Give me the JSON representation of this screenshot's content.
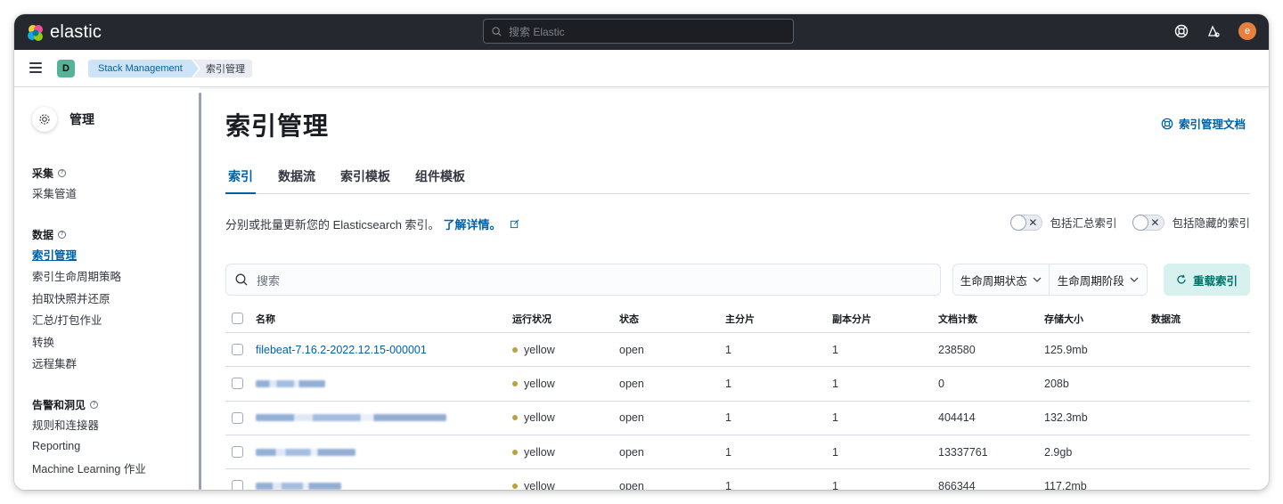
{
  "header": {
    "brand": "elastic",
    "search_placeholder": "搜索 Elastic",
    "user_initial": "e"
  },
  "breadcrumbs": {
    "space_initial": "D",
    "items": [
      "Stack Management",
      "索引管理"
    ]
  },
  "sidebar": {
    "title": "管理",
    "groups": [
      {
        "title": "采集",
        "items": [
          "采集管道"
        ]
      },
      {
        "title": "数据",
        "items": [
          "索引管理",
          "索引生命周期策略",
          "拍取快照并还原",
          "汇总/打包作业",
          "转换",
          "远程集群"
        ]
      },
      {
        "title": "告警和洞见",
        "items": [
          "规则和连接器",
          "Reporting",
          "Machine Learning 作业"
        ]
      }
    ]
  },
  "main": {
    "title": "索引管理",
    "doc_link": "索引管理文档",
    "tabs": [
      "索引",
      "数据流",
      "索引模板",
      "组件模板"
    ],
    "description": "分别或批量更新您的 Elasticsearch 索引。",
    "learn_more": "了解详情。",
    "toggle_rollup": "包括汇总索引",
    "toggle_hidden": "包括隐藏的索引",
    "search_placeholder": "搜索",
    "filter_lifecycle_status": "生命周期状态",
    "filter_lifecycle_phase": "生命周期阶段",
    "reload_button": "重载索引"
  },
  "table": {
    "columns": [
      "名称",
      "运行状况",
      "状态",
      "主分片",
      "副本分片",
      "文档计数",
      "存储大小",
      "数据流"
    ],
    "rows": [
      {
        "name": "filebeat-7.16.2-2022.12.15-000001",
        "health": "yellow",
        "status": "open",
        "primary": "1",
        "replicas": "1",
        "docs": "238580",
        "size": "125.9mb",
        "data_stream": ""
      },
      {
        "name": "",
        "health": "yellow",
        "status": "open",
        "primary": "1",
        "replicas": "1",
        "docs": "0",
        "size": "208b",
        "data_stream": ""
      },
      {
        "name": "",
        "health": "yellow",
        "status": "open",
        "primary": "1",
        "replicas": "1",
        "docs": "404414",
        "size": "132.3mb",
        "data_stream": ""
      },
      {
        "name": "",
        "health": "yellow",
        "status": "open",
        "primary": "1",
        "replicas": "1",
        "docs": "13337761",
        "size": "2.9gb",
        "data_stream": ""
      },
      {
        "name": "",
        "health": "yellow",
        "status": "open",
        "primary": "1",
        "replicas": "1",
        "docs": "866344",
        "size": "117.2mb",
        "data_stream": ""
      }
    ]
  },
  "colors": {
    "header_bg": "#25282f",
    "link": "#0061a6",
    "health_yellow": "#b9a33d",
    "reload_bg": "#d6f1ee"
  }
}
